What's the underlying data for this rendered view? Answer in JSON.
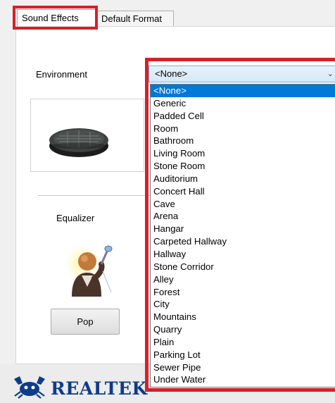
{
  "tabs": [
    {
      "label": "Sound Effects",
      "active": true
    },
    {
      "label": "Default Format",
      "active": false
    }
  ],
  "environment": {
    "label": "Environment",
    "selected": "<None>",
    "options": [
      "<None>",
      "Generic",
      "Padded Cell",
      "Room",
      "Bathroom",
      "Living Room",
      "Stone Room",
      "Auditorium",
      "Concert Hall",
      "Cave",
      "Arena",
      "Hangar",
      "Carpeted Hallway",
      "Hallway",
      "Stone Corridor",
      "Alley",
      "Forest",
      "City",
      "Mountains",
      "Quarry",
      "Plain",
      "Parking Lot",
      "Sewer Pipe",
      "Under Water"
    ]
  },
  "equalizer": {
    "label": "Equalizer",
    "preset_button": "Pop"
  },
  "brand": {
    "name": "REALTEK",
    "color": "#0d3c8c"
  },
  "icons": {
    "environment_preview": "manhole-cover-icon",
    "equalizer_preview": "singer-with-microphone-icon",
    "dropdown_arrow": "chevron-down-icon",
    "brand_logo": "realtek-crab-icon"
  },
  "colors": {
    "highlight": "#d81f2a",
    "selection": "#0078d7"
  }
}
